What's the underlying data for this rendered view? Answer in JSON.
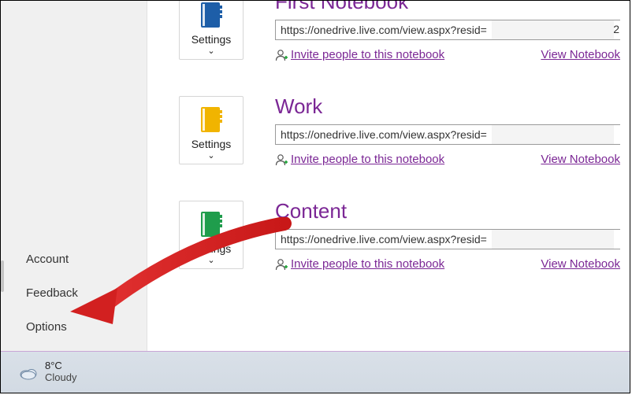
{
  "sidebar": {
    "items": [
      {
        "label": "Account"
      },
      {
        "label": "Feedback"
      },
      {
        "label": "Options"
      }
    ]
  },
  "settingsLabel": "Settings",
  "notebooks": [
    {
      "title": "First Notebook",
      "color": "#1d5ea8",
      "url": "https://onedrive.live.com/view.aspx?resid=",
      "urlTail": "2",
      "inviteLabel": "Invite people to this notebook",
      "viewLabel": "View Notebook"
    },
    {
      "title": "Work",
      "color": "#f1b400",
      "url": "https://onedrive.live.com/view.aspx?resid=",
      "urlTail": "",
      "inviteLabel": "Invite people to this notebook",
      "viewLabel": "View Notebook"
    },
    {
      "title": "Content",
      "color": "#1f9d4c",
      "url": "https://onedrive.live.com/view.aspx?resid=",
      "urlTail": "",
      "inviteLabel": "Invite people to this notebook",
      "viewLabel": "View Notebook"
    }
  ],
  "weather": {
    "temperature": "8°C",
    "condition": "Cloudy"
  }
}
